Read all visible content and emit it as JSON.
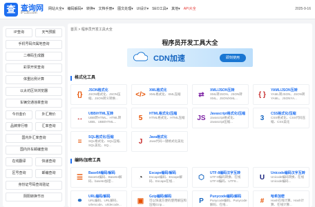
{
  "header": {
    "logo_letter": "查",
    "site_name": "查询网",
    "site_domain": "iP138.com",
    "nav": [
      "网站大全▾",
      "编码解码▾",
      "转换▾",
      "文档手册▾",
      "图文处理▾",
      "UI设计▾",
      "SEO工具▾",
      "其他▾",
      "API大全"
    ],
    "date": "2025-9-16"
  },
  "sidebar": {
    "rows": [
      [
        "IP查询",
        "天气预报"
      ],
      [
        "手机号码归属地查询"
      ],
      [
        "二维码生成器"
      ],
      [
        "彩票开奖查询"
      ],
      [
        "体重比例计算"
      ],
      [
        "以太坊区块浏览器"
      ],
      [
        "车辆交通违章查询"
      ],
      [
        "今日金价",
        "外汇牌价"
      ],
      [
        "品牌排行榜",
        "汇率查询"
      ],
      [
        "国内外汇率查询"
      ],
      [
        "国内外车邮编查询"
      ],
      [
        "在线翻译",
        "快递查询"
      ],
      [
        "区号查询",
        "邮编查询"
      ],
      [
        "身份证号码查询验证"
      ],
      [
        "阴阳转换节日"
      ]
    ]
  },
  "main": {
    "breadcrumb": "首页 > 程序员开发工具大全",
    "title": "程序员开发工具大全",
    "banner": {
      "text": "CDN加速",
      "button": "即刻使用"
    },
    "sections": [
      {
        "title": "格式化工具",
        "cards": [
          {
            "title": "JSON格式化",
            "desc": "JSON格式化、JSON压缩、JSON转义转换...",
            "icon": "{}",
            "color": "#e65100",
            "icon_name": "json-icon"
          },
          {
            "title": "XML格式化",
            "desc": "XML格式化、XML压缩",
            "icon": "</>",
            "color": "#e65100",
            "icon_name": "xml-icon"
          },
          {
            "title": "XML/JSON互转",
            "desc": "XML转JSON、JSON转XML、JSON/XML...",
            "icon": "⇄",
            "color": "#7b1fa2",
            "icon_name": "xml-json-convert-icon"
          },
          {
            "title": "YAML/JSON互转",
            "desc": "YAML转JSON、JSON转YAML、JSONYA...",
            "icon": "{ }",
            "color": "#c62828",
            "icon_name": "yaml-json-convert-icon"
          },
          {
            "title": "UBB/HTML互转",
            "desc": "UBB转HTML、HTML转UBB、UBB/HTML...",
            "icon": "↔",
            "color": "#c62828",
            "icon_name": "ubb-html-icon"
          },
          {
            "title": "HTML格式化/压缩",
            "desc": "HTML格式化、HTML压缩",
            "icon": "5",
            "color": "#e65100",
            "icon_name": "html-icon"
          },
          {
            "title": "Javascript格式化/压缩",
            "desc": "Javascript格式化、Javascript压缩...",
            "icon": "JS",
            "color": "#7b1fa2",
            "icon_name": "javascript-icon"
          },
          {
            "title": "CSS格式化/压缩",
            "desc": "CSS格式化、CSS代码压缩、CSS美化",
            "icon": "3",
            "color": "#1565c0",
            "icon_name": "css-icon"
          },
          {
            "title": "SQL格式化/压缩",
            "desc": "SQL格式化、SQL压缩、SQL美化、SQ...",
            "icon": "≡",
            "color": "#e65100",
            "icon_name": "sql-icon"
          },
          {
            "title": "Java格式化",
            "desc": "Java代码一键格式化美化",
            "icon": "J",
            "color": "#c62828",
            "icon_name": "java-icon"
          }
        ]
      },
      {
        "title": "编码/加密工具",
        "cards": [
          {
            "title": "Base64编码/解码",
            "desc": "Base64编码、Base64解码、base64加密...",
            "icon": "☰",
            "color": "#e65100",
            "icon_name": "base64-icon"
          },
          {
            "title": "Escape编码/解码",
            "desc": "Escape编码、Escape解码、Escape在线...",
            "icon": "◔",
            "color": "#222222",
            "icon_name": "escape-icon"
          },
          {
            "title": "UTF-8编码汉字互转",
            "desc": "UTF-8编码转换、在线UTF-8编码、UTF8...",
            "icon": "⬡",
            "color": "#1565c0",
            "icon_name": "utf8-icon"
          },
          {
            "title": "Unicode编码汉字互转",
            "desc": "Unicode编码转换、在线Unicode编码...",
            "icon": "U",
            "color": "#1a237e",
            "icon_name": "unicode-icon"
          },
          {
            "title": "URL编码/解码",
            "desc": "URL编码、URL解码、urlencode、urldecode...",
            "icon": "⚭",
            "color": "#1565c0",
            "icon_name": "url-icon"
          },
          {
            "title": "Gzip编码/解码",
            "desc": "可以快速方便的使用解压和压缩Gzip...",
            "icon": "▣",
            "color": "#e65100",
            "icon_name": "gzip-icon"
          },
          {
            "title": "Punycode编码/解码",
            "desc": "Punycode编码、Punycode解码、在线...",
            "icon": "P",
            "color": "#1565c0",
            "icon_name": "punycode-icon"
          },
          {
            "title": "哈希加密",
            "desc": "Hash在线计算、Hash计算、在线计算...",
            "icon": "#",
            "color": "#e65100",
            "icon_name": "hash-icon"
          }
        ]
      }
    ]
  }
}
